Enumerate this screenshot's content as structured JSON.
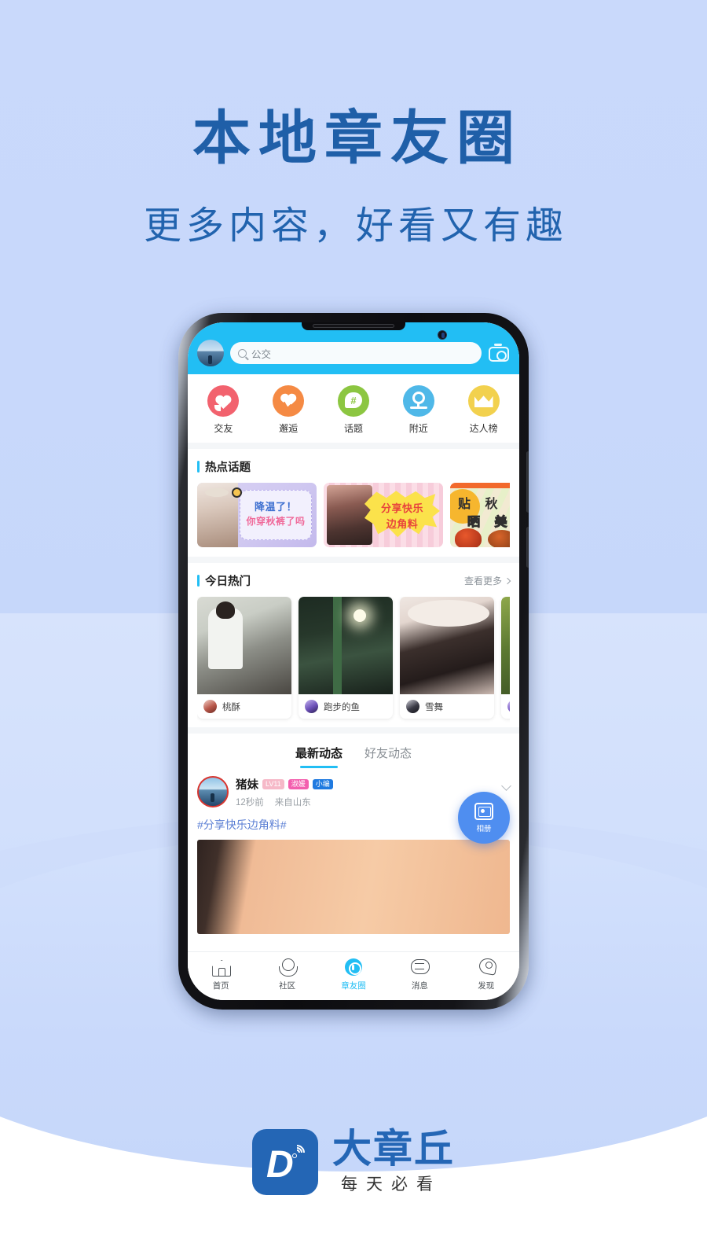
{
  "hero": {
    "headline": "本地章友圈",
    "subheadline": "更多内容，好看又有趣"
  },
  "colors": {
    "brand_blue": "#2466B5",
    "accent_cyan": "#22BEF4",
    "page_bg": "#c9d9fb",
    "fab_blue": "#4f8ef0"
  },
  "phone": {
    "topbar": {
      "avatar_icon": "user-avatar",
      "search_value": "公交",
      "search_icon": "search-icon",
      "camera_icon": "camera-icon"
    },
    "quicknav": [
      {
        "label": "交友",
        "icon": "heart-chat-icon",
        "color": "#F2626E"
      },
      {
        "label": "邂逅",
        "icon": "heart-pulse-icon",
        "color": "#F58A44"
      },
      {
        "label": "话题",
        "icon": "hashtag-chat-icon",
        "color": "#8CC641"
      },
      {
        "label": "附近",
        "icon": "location-pin-icon",
        "color": "#4FB8E8"
      },
      {
        "label": "达人榜",
        "icon": "crown-icon",
        "color": "#F2D14E"
      }
    ],
    "hot_topics": {
      "title": "热点话题",
      "cards": [
        {
          "line1": "降温了！",
          "line2": "你穿秋裤了吗"
        },
        {
          "line1": "分享快乐",
          "line2": "边角料"
        },
        {
          "line1": "贴 秋",
          "line2": "晒 美"
        }
      ]
    },
    "hot_today": {
      "title": "今日热门",
      "more_label": "查看更多",
      "more_icon": "chevron-right-icon",
      "cards": [
        {
          "author": "桃酥"
        },
        {
          "author": "跑步的鱼"
        },
        {
          "author": "雪舞"
        },
        {
          "author": ""
        }
      ]
    },
    "feed": {
      "tabs": [
        {
          "label": "最新动态",
          "active": true
        },
        {
          "label": "好友动态",
          "active": false
        }
      ],
      "post": {
        "username": "猪妹",
        "badges": [
          {
            "text": "LV11",
            "color": "#f6b9c8"
          },
          {
            "text": "淑媛",
            "color": "#f35fae"
          },
          {
            "text": "小编",
            "color": "#1f7ae0"
          }
        ],
        "time": "12秒前",
        "location": "来自山东",
        "tag": "#分享快乐边角料#",
        "expand_icon": "chevron-down-icon"
      },
      "fab": {
        "label": "相册",
        "icon": "album-photo-icon"
      }
    },
    "tabbar": [
      {
        "label": "首页",
        "icon": "home-icon",
        "active": false
      },
      {
        "label": "社区",
        "icon": "community-icon",
        "active": false
      },
      {
        "label": "章友圈",
        "icon": "circle-icon",
        "active": true
      },
      {
        "label": "消息",
        "icon": "message-icon",
        "active": false
      },
      {
        "label": "发现",
        "icon": "discover-icon",
        "active": false
      }
    ]
  },
  "footer": {
    "logo_letter": "D",
    "brand_name": "大章丘",
    "brand_tagline": "每天必看"
  }
}
